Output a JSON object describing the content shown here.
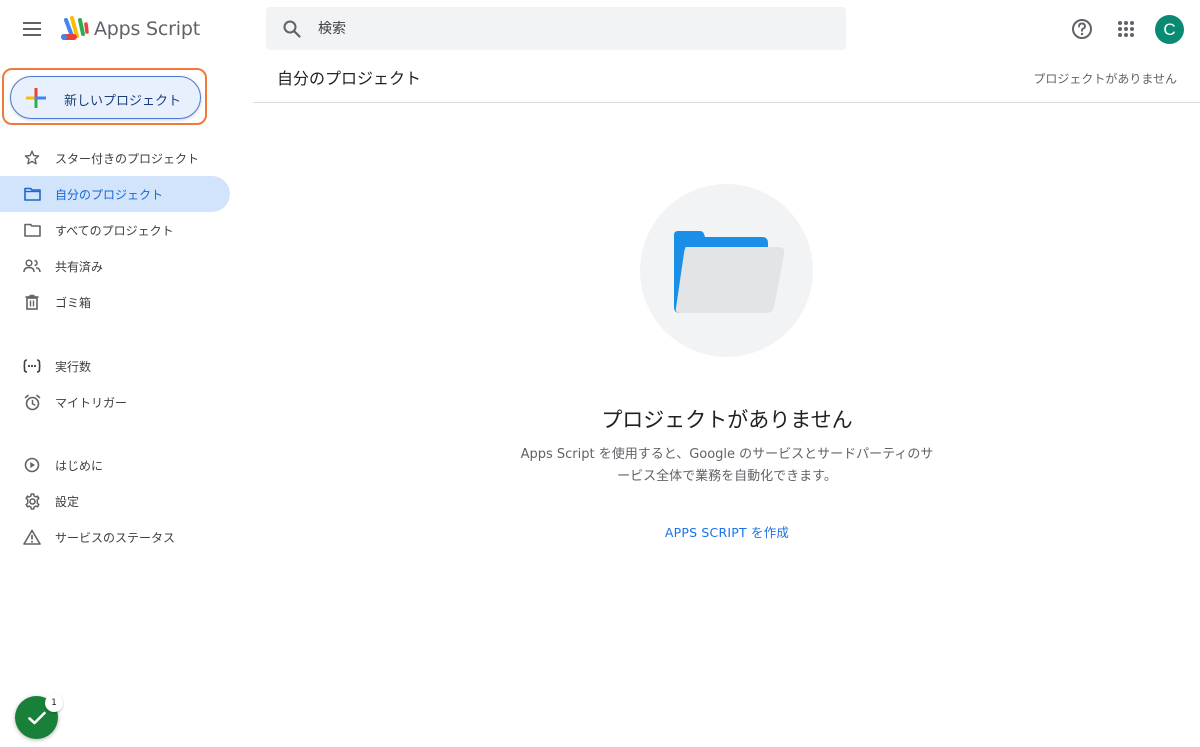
{
  "header": {
    "app_title": "Apps Script",
    "search_placeholder": "検索",
    "avatar_initial": "C"
  },
  "sidebar": {
    "new_project_label": "新しいプロジェクト",
    "items": [
      {
        "label": "スター付きのプロジェクト",
        "icon": "star-icon"
      },
      {
        "label": "自分のプロジェクト",
        "icon": "folder-icon",
        "active": true
      },
      {
        "label": "すべてのプロジェクト",
        "icon": "folder-outline-icon"
      },
      {
        "label": "共有済み",
        "icon": "people-icon"
      },
      {
        "label": "ゴミ箱",
        "icon": "trash-icon"
      },
      {
        "label": "実行数",
        "icon": "executions-icon"
      },
      {
        "label": "マイトリガー",
        "icon": "alarm-icon"
      },
      {
        "label": "はじめに",
        "icon": "play-circle-icon"
      },
      {
        "label": "設定",
        "icon": "gear-icon"
      },
      {
        "label": "サービスのステータス",
        "icon": "warning-icon"
      }
    ]
  },
  "main": {
    "title": "自分のプロジェクト",
    "status": "プロジェクトがありません",
    "empty_title": "プロジェクトがありません",
    "empty_desc_line1": "Apps Script を使用すると、Google のサービスとサードパーティのサ",
    "empty_desc_line2": "ービス全体で業務を自動化できます。",
    "create_link": "APPS SCRIPT を作成"
  },
  "badge": {
    "count": "1"
  },
  "colors": {
    "accent": "#1a73e8",
    "active_nav_bg": "#d2e3fc",
    "avatar_bg": "#0b8a73",
    "highlight_border": "#f07a3c",
    "folder_blue": "#1a8fe8",
    "check_green": "#188038"
  }
}
